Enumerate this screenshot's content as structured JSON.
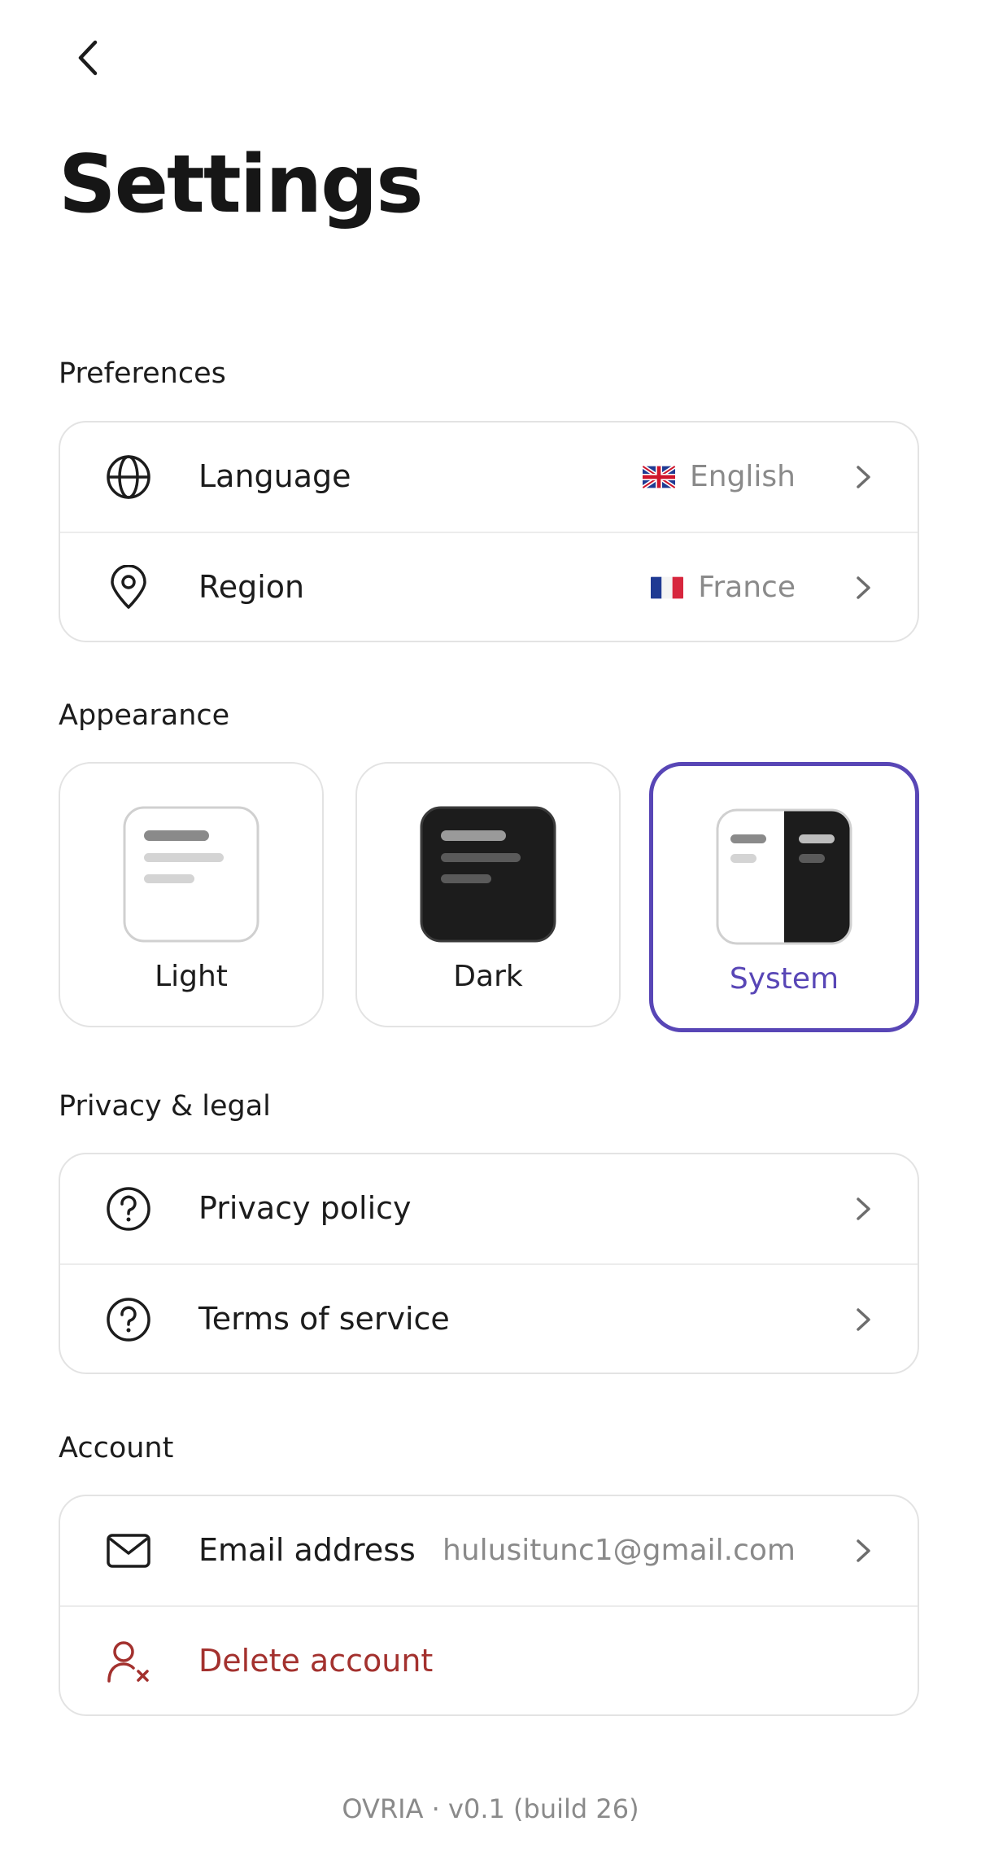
{
  "page": {
    "title": "Settings"
  },
  "sections": {
    "preferences": "Preferences",
    "appearance": "Appearance",
    "privacy": "Privacy & legal",
    "account": "Account"
  },
  "preferences": {
    "language": {
      "label": "Language",
      "value": "English",
      "flag_icon": "flag-uk-icon"
    },
    "region": {
      "label": "Region",
      "value": "France",
      "flag_icon": "flag-france-icon"
    }
  },
  "appearance": {
    "selected": "system",
    "options": [
      {
        "id": "light",
        "label": "Light"
      },
      {
        "id": "dark",
        "label": "Dark"
      },
      {
        "id": "system",
        "label": "System"
      }
    ]
  },
  "privacy": {
    "privacy_policy": "Privacy policy",
    "terms": "Terms of service"
  },
  "account": {
    "email_label": "Email address",
    "email_value": "hulusitunc1@gmail.com",
    "delete_label": "Delete account"
  },
  "footer": {
    "version": "OVRIA · v0.1 (build 26)"
  },
  "colors": {
    "accent": "#5846b6",
    "danger": "#a3312e",
    "muted": "#8a8a8a",
    "border": "#e3e3e3"
  }
}
